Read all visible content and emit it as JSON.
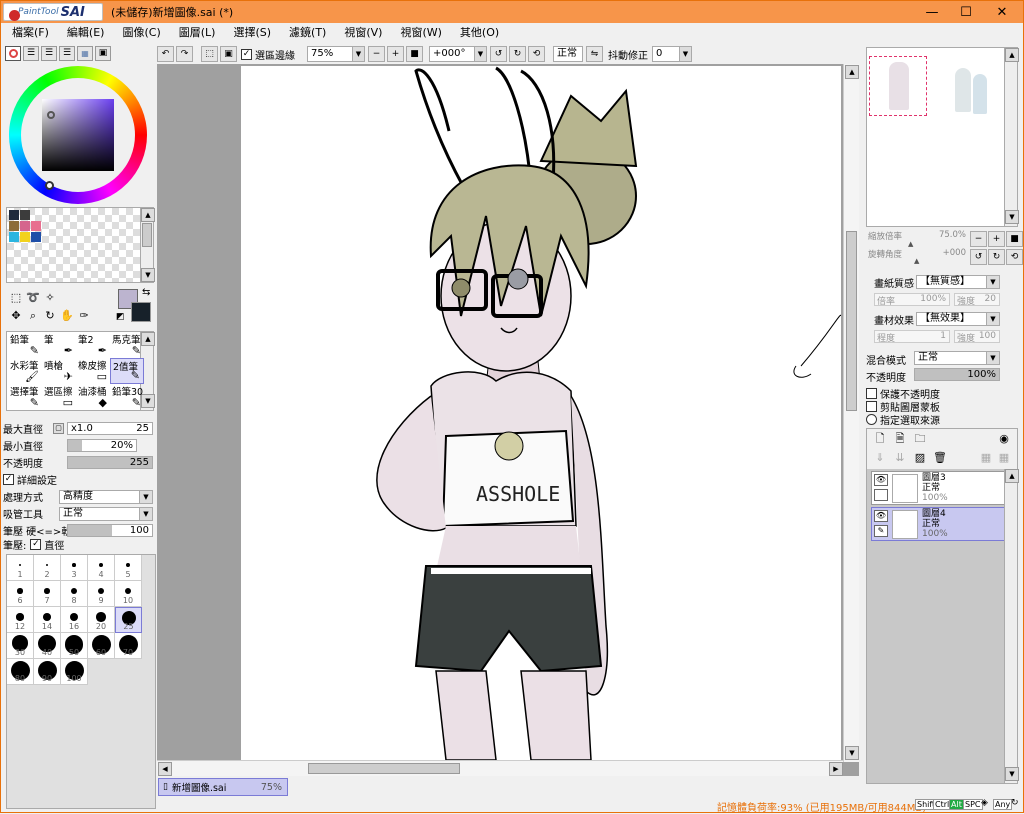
{
  "window": {
    "logo_small": "PaintTool",
    "logo_big": "SAI",
    "title": "(未儲存)新增圖像.sai (*)",
    "controls": [
      "—",
      "☐",
      "✕"
    ]
  },
  "menu": [
    "檔案(F)",
    "編輯(E)",
    "圖像(C)",
    "圖層(L)",
    "選擇(S)",
    "濾鏡(T)",
    "視窗(V)",
    "視窗(W)",
    "其他(O)"
  ],
  "toolbar": {
    "selection_edge_label": "選區邊緣",
    "zoom": "75%",
    "rotation": "+000°",
    "blend": "正常",
    "stabilizer_label": "抖動修正",
    "stabilizer": "0"
  },
  "brushes": [
    {
      "label": "鉛筆",
      "icon": "✎"
    },
    {
      "label": "筆",
      "icon": "✒"
    },
    {
      "label": "筆2",
      "icon": "✒"
    },
    {
      "label": "馬克筆",
      "icon": "✎"
    },
    {
      "label": "水彩筆",
      "icon": "🖌"
    },
    {
      "label": "噴槍",
      "icon": "✈"
    },
    {
      "label": "橡皮擦",
      "icon": "▭"
    },
    {
      "label": "2值筆",
      "icon": "✎"
    },
    {
      "label": "選擇筆",
      "icon": "✎"
    },
    {
      "label": "選區擦",
      "icon": "▭"
    },
    {
      "label": "油漆桶",
      "icon": "◆"
    },
    {
      "label": "鉛筆30",
      "icon": "✎"
    }
  ],
  "brush_props": {
    "max_size_label": "最大直徑",
    "max_size_mult": "x1.0",
    "max_size": "25",
    "min_size_label": "最小直徑",
    "min_size": "20%",
    "min_size_fraction": 0.2,
    "opacity_label": "不透明度",
    "opacity": "255",
    "opacity_fraction": 1.0,
    "detail_label": "詳細設定",
    "process_label": "處理方式",
    "process": "高精度",
    "dropper_label": "吸管工具",
    "dropper": "正常",
    "pressure_label": "筆壓 硬<=>軟",
    "pressure": "100",
    "pressure_fraction": 1.0,
    "pressure2_label": "筆壓:",
    "pressure2_opt": "直徑"
  },
  "sizes": [
    {
      "v": "1"
    },
    {
      "v": "2"
    },
    {
      "v": "3"
    },
    {
      "v": "4"
    },
    {
      "v": "5"
    },
    {
      "v": "6"
    },
    {
      "v": "7"
    },
    {
      "v": "8"
    },
    {
      "v": "9"
    },
    {
      "v": "10"
    },
    {
      "v": "12"
    },
    {
      "v": "14"
    },
    {
      "v": "16"
    },
    {
      "v": "20"
    },
    {
      "v": "25"
    },
    {
      "v": "30"
    },
    {
      "v": "40"
    },
    {
      "v": "50"
    },
    {
      "v": "60"
    },
    {
      "v": "70"
    },
    {
      "v": "80"
    },
    {
      "v": "90"
    },
    {
      "v": "100"
    }
  ],
  "selected_size": "25",
  "palette_colors": [
    "#1f2a3c",
    "#3c3c3c",
    "#8c6d3a",
    "#d5658d",
    "#e86f8f",
    "#2bb5e0",
    "#f2d21c",
    "#1e4ea8"
  ],
  "navigator": {
    "zoom_label": "縮放倍率",
    "zoom": "75.0%",
    "angle_label": "旋轉角度",
    "angle": "+000"
  },
  "layer_props": {
    "paper_label": "畫紙質感",
    "paper": "【無質感】",
    "scale_label": "倍率",
    "scale": "100%",
    "strength_label": "強度",
    "strength": "20",
    "effect_label": "畫材效果",
    "effect": "【無效果】",
    "width_label": "程度",
    "width": "1",
    "strength2_label": "強度",
    "strength2": "100",
    "blend_label": "混合模式",
    "blend": "正常",
    "opacity_label": "不透明度",
    "opacity": "100%",
    "opacity_fraction": 1.0,
    "preserve_label": "保護不透明度",
    "clip_label": "剪貼圖層蒙板",
    "source_label": "指定選取來源"
  },
  "layers": [
    {
      "name": "圖層3",
      "mode": "正常",
      "opacity": "100%"
    },
    {
      "name": "圖層4",
      "mode": "正常",
      "opacity": "100%"
    }
  ],
  "document_tab": {
    "name": "新增圖像.sai",
    "zoom": "75%"
  },
  "status": {
    "memory": "記憶體負荷率:93% (已用195MB/可用844MB)",
    "keys": [
      "Shift",
      "Ctrl",
      "Alt",
      "SPC",
      "◈",
      "Any"
    ]
  },
  "canvas_text": "ASSHOLE",
  "colors": {
    "titlebar": "#f7954a",
    "selection": "#c8c8f0",
    "accent": "#e8710a"
  }
}
